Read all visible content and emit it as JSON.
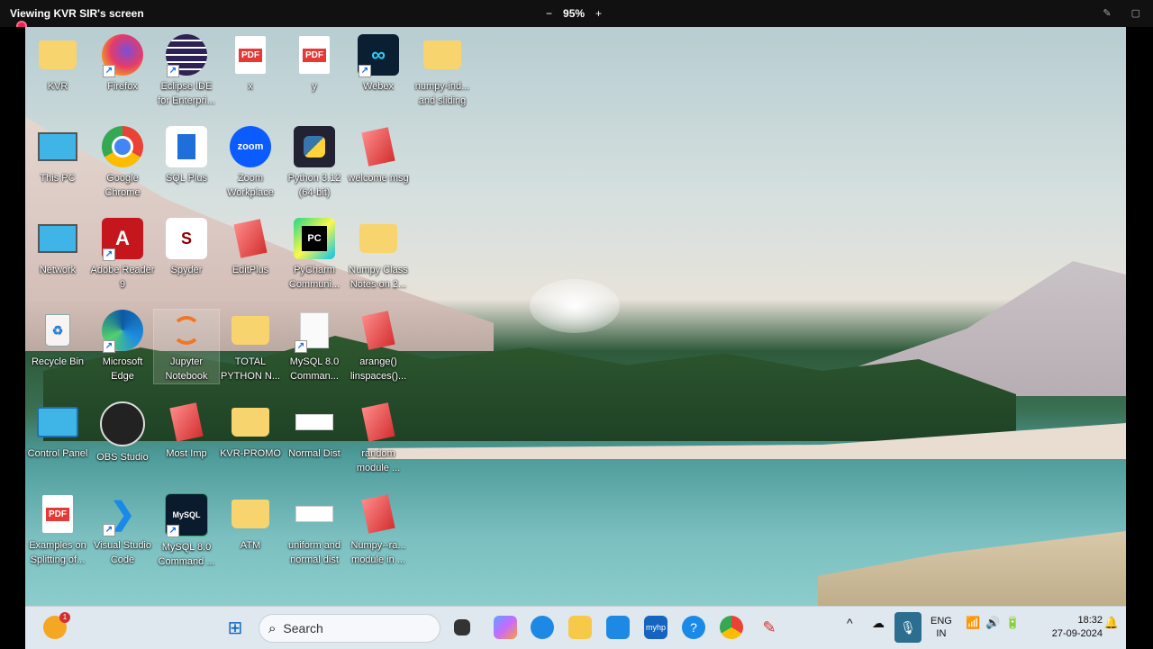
{
  "viewer": {
    "title": "Viewing KVR SIR's screen",
    "zoom": "95%",
    "zoom_out": "−",
    "zoom_in": "+"
  },
  "desktop_icons": [
    {
      "label": "KVR",
      "icon": "user-folder-icon"
    },
    {
      "label": "Firefox",
      "icon": "firefox-icon"
    },
    {
      "label": "Eclipse IDE for Enterpri...",
      "icon": "eclipse-icon"
    },
    {
      "label": "x",
      "icon": "pdf-icon"
    },
    {
      "label": "y",
      "icon": "pdf-icon"
    },
    {
      "label": "Webex",
      "icon": "webex-icon"
    },
    {
      "label": "numpy-ind... and sliding",
      "icon": "folder-icon"
    },
    {
      "label": "This PC",
      "icon": "monitor-icon"
    },
    {
      "label": "Google Chrome",
      "icon": "chrome-icon"
    },
    {
      "label": "SQL Plus",
      "icon": "sqlplus-icon"
    },
    {
      "label": "Zoom Workplace",
      "icon": "zoom-icon"
    },
    {
      "label": "Python 3.12 (64-bit)",
      "icon": "python-icon"
    },
    {
      "label": "welcome msg",
      "icon": "editplus-file-icon"
    },
    {
      "label": "Network",
      "icon": "network-icon"
    },
    {
      "label": "Adobe Reader 9",
      "icon": "adobe-icon"
    },
    {
      "label": "Spyder",
      "icon": "spyder-icon"
    },
    {
      "label": "EditPlus",
      "icon": "editplus-icon"
    },
    {
      "label": "PyCharm Communi...",
      "icon": "pycharm-icon"
    },
    {
      "label": "Numpy Class Notes on 2...",
      "icon": "folder-icon"
    },
    {
      "label": "Recycle Bin",
      "icon": "recycle-bin-icon"
    },
    {
      "label": "Microsoft Edge",
      "icon": "edge-icon"
    },
    {
      "label": "Jupyter Notebook",
      "icon": "jupyter-icon"
    },
    {
      "label": "TOTAL PYTHON N...",
      "icon": "folder-icon"
    },
    {
      "label": "MySQL 8.0 Comman...",
      "icon": "document-icon"
    },
    {
      "label": "arange() linspaces()...",
      "icon": "editplus-file-icon"
    },
    {
      "label": "Control Panel",
      "icon": "control-panel-icon"
    },
    {
      "label": "OBS Studio",
      "icon": "obs-icon"
    },
    {
      "label": "Most Imp",
      "icon": "editplus-file-icon"
    },
    {
      "label": "KVR-PROMO",
      "icon": "folder-icon"
    },
    {
      "label": "Normal Dist",
      "icon": "image-file-icon"
    },
    {
      "label": "random module ...",
      "icon": "editplus-file-icon"
    },
    {
      "label": "Examples on Splitting of...",
      "icon": "pdf-icon"
    },
    {
      "label": "Visual Studio Code",
      "icon": "vscode-icon"
    },
    {
      "label": "MySQL 8.0 Command ...",
      "icon": "mysql-icon"
    },
    {
      "label": "ATM",
      "icon": "folder-icon"
    },
    {
      "label": "uniform and normal dist",
      "icon": "image-file-icon"
    },
    {
      "label": "Numpy--ra... module in ...",
      "icon": "editplus-file-icon"
    }
  ],
  "taskbar": {
    "search_placeholder": "Search",
    "notification_count": "1",
    "lang_line1": "ENG",
    "lang_line2": "IN",
    "time": "18:32",
    "date": "27-09-2024",
    "myhp_label": "myhp",
    "pdf_label": "PDF",
    "zoom_label": "zoom",
    "pc_label": "PC",
    "sql_label": "MySQL"
  }
}
